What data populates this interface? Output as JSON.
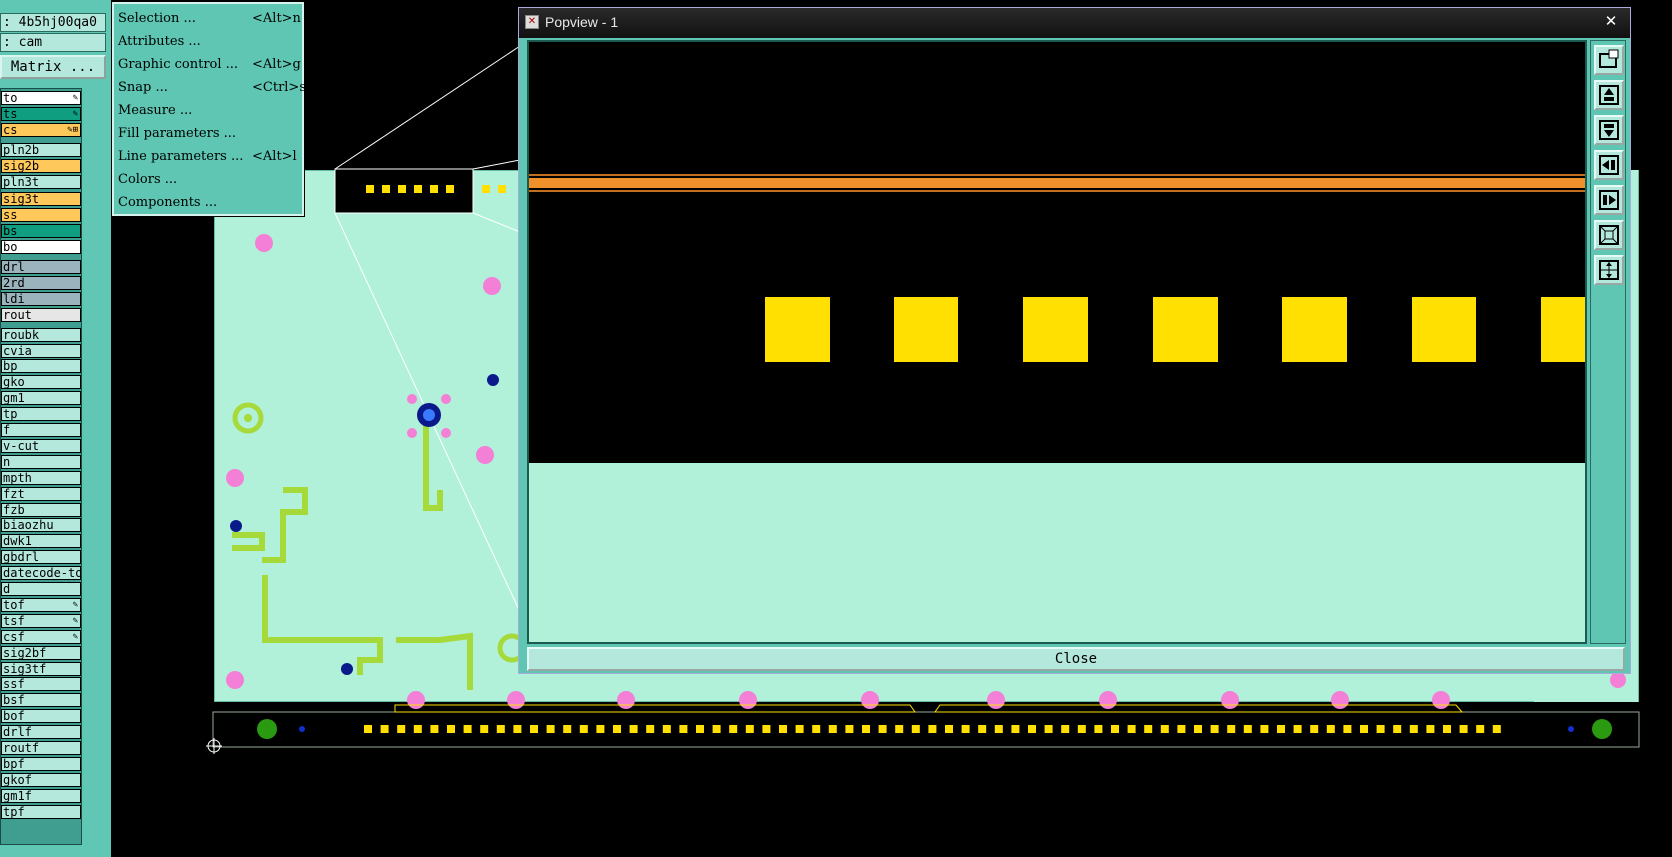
{
  "job_header": {
    "job_line": ": 4b5hj00qa0",
    "step_line": ": cam",
    "matrix_button": "Matrix ..."
  },
  "layers": [
    {
      "name": "to",
      "color": "#ffffff",
      "mark": "✎"
    },
    {
      "name": "ts",
      "color": "#0f9e7f",
      "mark": "✎"
    },
    {
      "name": "cs",
      "color": "#ffc85a",
      "mark": "✎⊞"
    },
    {
      "name": "pln2b",
      "color": "#b5e8dc"
    },
    {
      "name": "sig2b",
      "color": "#ffc85a"
    },
    {
      "name": "pln3t",
      "color": "#b5e8dc"
    },
    {
      "name": "sig3t",
      "color": "#ffc85a"
    },
    {
      "name": "ss",
      "color": "#ffc85a"
    },
    {
      "name": "bs",
      "color": "#0f9e7f"
    },
    {
      "name": "bo",
      "color": "#ffffff"
    },
    {
      "name": "drl",
      "color": "#9bb3bc"
    },
    {
      "name": "2rd",
      "color": "#9bb3bc"
    },
    {
      "name": "ldi",
      "color": "#9bb3bc"
    },
    {
      "name": "rout",
      "color": "#e6e6e6"
    },
    {
      "name": "roubk",
      "color": "#b5e8dc"
    },
    {
      "name": "cvia",
      "color": "#b5e8dc"
    },
    {
      "name": "bp",
      "color": "#b5e8dc"
    },
    {
      "name": "gko",
      "color": "#b5e8dc"
    },
    {
      "name": "gm1",
      "color": "#b5e8dc"
    },
    {
      "name": "tp",
      "color": "#b5e8dc"
    },
    {
      "name": "f",
      "color": "#b5e8dc"
    },
    {
      "name": "v-cut",
      "color": "#b5e8dc"
    },
    {
      "name": "n",
      "color": "#b5e8dc"
    },
    {
      "name": "mpth",
      "color": "#b5e8dc"
    },
    {
      "name": "fzt",
      "color": "#b5e8dc"
    },
    {
      "name": "fzb",
      "color": "#b5e8dc"
    },
    {
      "name": "biaozhu",
      "color": "#b5e8dc"
    },
    {
      "name": "dwk1",
      "color": "#b5e8dc"
    },
    {
      "name": "gbdrl",
      "color": "#b5e8dc"
    },
    {
      "name": "datecode-to",
      "color": "#b5e8dc"
    },
    {
      "name": "d",
      "color": "#b5e8dc"
    },
    {
      "name": "tof",
      "color": "#b5e8dc",
      "mark": "✎"
    },
    {
      "name": "tsf",
      "color": "#b5e8dc",
      "mark": "✎"
    },
    {
      "name": "csf",
      "color": "#b5e8dc",
      "mark": "✎"
    },
    {
      "name": "sig2bf",
      "color": "#b5e8dc"
    },
    {
      "name": "sig3tf",
      "color": "#b5e8dc"
    },
    {
      "name": "ssf",
      "color": "#b5e8dc"
    },
    {
      "name": "bsf",
      "color": "#b5e8dc"
    },
    {
      "name": "bof",
      "color": "#b5e8dc"
    },
    {
      "name": "drlf",
      "color": "#b5e8dc"
    },
    {
      "name": "routf",
      "color": "#b5e8dc"
    },
    {
      "name": "bpf",
      "color": "#b5e8dc"
    },
    {
      "name": "gkof",
      "color": "#b5e8dc"
    },
    {
      "name": "gm1f",
      "color": "#b5e8dc"
    },
    {
      "name": "tpf",
      "color": "#b5e8dc"
    }
  ],
  "menu": [
    {
      "label": "Selection ...",
      "shortcut": "<Alt>n"
    },
    {
      "label": "Attributes ...",
      "shortcut": ""
    },
    {
      "label": "Graphic control ...",
      "shortcut": "<Alt>g"
    },
    {
      "label": "Snap ...",
      "shortcut": "<Ctrl>s"
    },
    {
      "label": "Measure ...",
      "shortcut": ""
    },
    {
      "label": "Fill parameters ...",
      "shortcut": ""
    },
    {
      "label": "Line parameters ...",
      "shortcut": "<Alt>l"
    },
    {
      "label": "Colors ...",
      "shortcut": ""
    },
    {
      "label": "Components ...",
      "shortcut": ""
    }
  ],
  "popview": {
    "title": "Popview - 1",
    "close_label": "Close",
    "close_x": "✕",
    "tools": [
      "zoom-window-icon",
      "pan-up-icon",
      "pan-down-icon",
      "pan-left-icon",
      "pan-right-icon",
      "zoom-fit-icon",
      "zoom-home-icon"
    ]
  },
  "colors": {
    "board": "#b1f1da",
    "copper": "#a6d93a",
    "pad": "#ffe000",
    "via": "#f47fd6",
    "trace_orange": "#f0902a",
    "panel": "#5ec6b2"
  }
}
